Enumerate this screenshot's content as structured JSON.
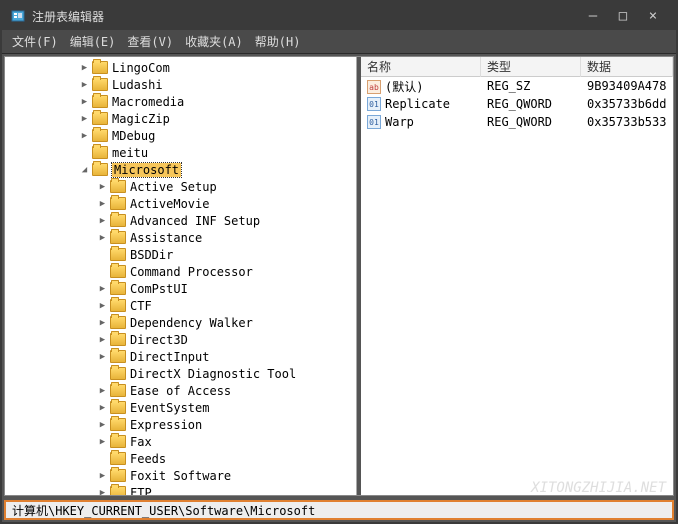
{
  "window": {
    "title": "注册表编辑器",
    "minimize": "—",
    "maximize": "□",
    "close": "×"
  },
  "menu": {
    "file": "文件(F)",
    "edit": "编辑(E)",
    "view": "查看(V)",
    "favorites": "收藏夹(A)",
    "help": "帮助(H)"
  },
  "tree": {
    "top_level": [
      {
        "label": "LingoCom",
        "depth": 3,
        "exp": "▶"
      },
      {
        "label": "Ludashi",
        "depth": 3,
        "exp": "▶"
      },
      {
        "label": "Macromedia",
        "depth": 3,
        "exp": "▶"
      },
      {
        "label": "MagicZip",
        "depth": 3,
        "exp": "▶"
      },
      {
        "label": "MDebug",
        "depth": 3,
        "exp": "▶"
      },
      {
        "label": "meitu",
        "depth": 3,
        "exp": ""
      }
    ],
    "selected": {
      "label": "Microsoft",
      "depth": 3,
      "exp": "◢"
    },
    "children": [
      {
        "label": "Active Setup",
        "depth": 4,
        "exp": "▶"
      },
      {
        "label": "ActiveMovie",
        "depth": 4,
        "exp": "▶"
      },
      {
        "label": "Advanced INF Setup",
        "depth": 4,
        "exp": "▶"
      },
      {
        "label": "Assistance",
        "depth": 4,
        "exp": "▶"
      },
      {
        "label": "BSDDir",
        "depth": 4,
        "exp": ""
      },
      {
        "label": "Command Processor",
        "depth": 4,
        "exp": ""
      },
      {
        "label": "ComPstUI",
        "depth": 4,
        "exp": "▶"
      },
      {
        "label": "CTF",
        "depth": 4,
        "exp": "▶"
      },
      {
        "label": "Dependency Walker",
        "depth": 4,
        "exp": "▶"
      },
      {
        "label": "Direct3D",
        "depth": 4,
        "exp": "▶"
      },
      {
        "label": "DirectInput",
        "depth": 4,
        "exp": "▶"
      },
      {
        "label": "DirectX Diagnostic Tool",
        "depth": 4,
        "exp": ""
      },
      {
        "label": "Ease of Access",
        "depth": 4,
        "exp": "▶"
      },
      {
        "label": "EventSystem",
        "depth": 4,
        "exp": "▶"
      },
      {
        "label": "Expression",
        "depth": 4,
        "exp": "▶"
      },
      {
        "label": "Fax",
        "depth": 4,
        "exp": "▶"
      },
      {
        "label": "Feeds",
        "depth": 4,
        "exp": ""
      },
      {
        "label": "Foxit Software",
        "depth": 4,
        "exp": "▶"
      },
      {
        "label": "FTP",
        "depth": 4,
        "exp": "▶"
      }
    ]
  },
  "grid": {
    "headers": {
      "name": "名称",
      "type": "类型",
      "data": "数据"
    },
    "rows": [
      {
        "icon": "str",
        "icon_txt": "ab",
        "name": "(默认)",
        "type": "REG_SZ",
        "data": "9B93409A478"
      },
      {
        "icon": "bin",
        "icon_txt": "01",
        "name": "Replicate",
        "type": "REG_QWORD",
        "data": "0x35733b6dd"
      },
      {
        "icon": "bin",
        "icon_txt": "01",
        "name": "Warp",
        "type": "REG_QWORD",
        "data": "0x35733b533"
      }
    ]
  },
  "status": {
    "path": "计算机\\HKEY_CURRENT_USER\\Software\\Microsoft"
  },
  "watermark": "XITONGZHIJIA.NET"
}
